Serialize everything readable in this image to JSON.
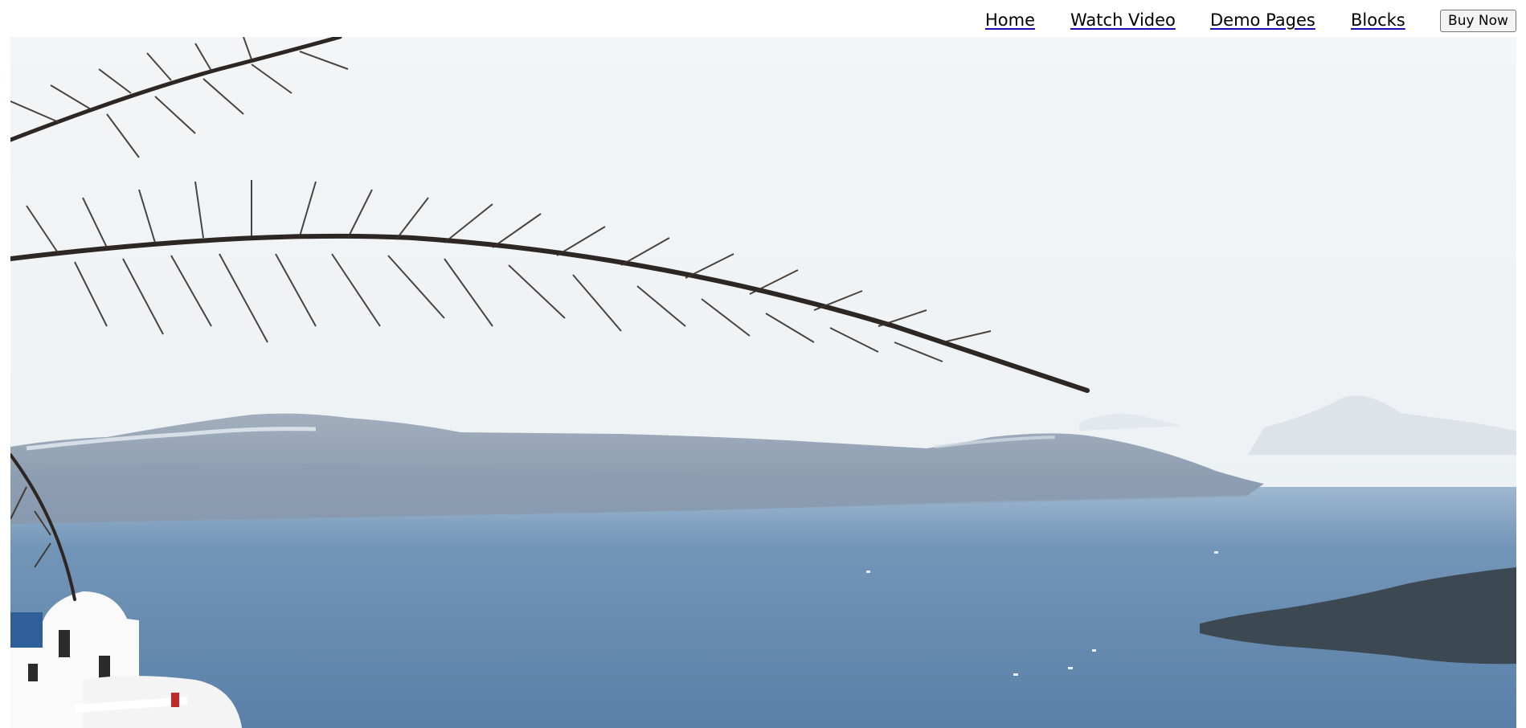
{
  "nav": {
    "items": [
      {
        "label": "Home"
      },
      {
        "label": "Watch Video"
      },
      {
        "label": "Demo Pages"
      },
      {
        "label": "Blocks"
      }
    ],
    "buy_label": "Buy Now"
  },
  "hero": {
    "icon": "photo-santorini-caldera",
    "colors": {
      "sky": "#f4f6f7",
      "sea": "#5f86ad",
      "cliff": "#8d9db1",
      "palm": "#2e2622"
    }
  }
}
